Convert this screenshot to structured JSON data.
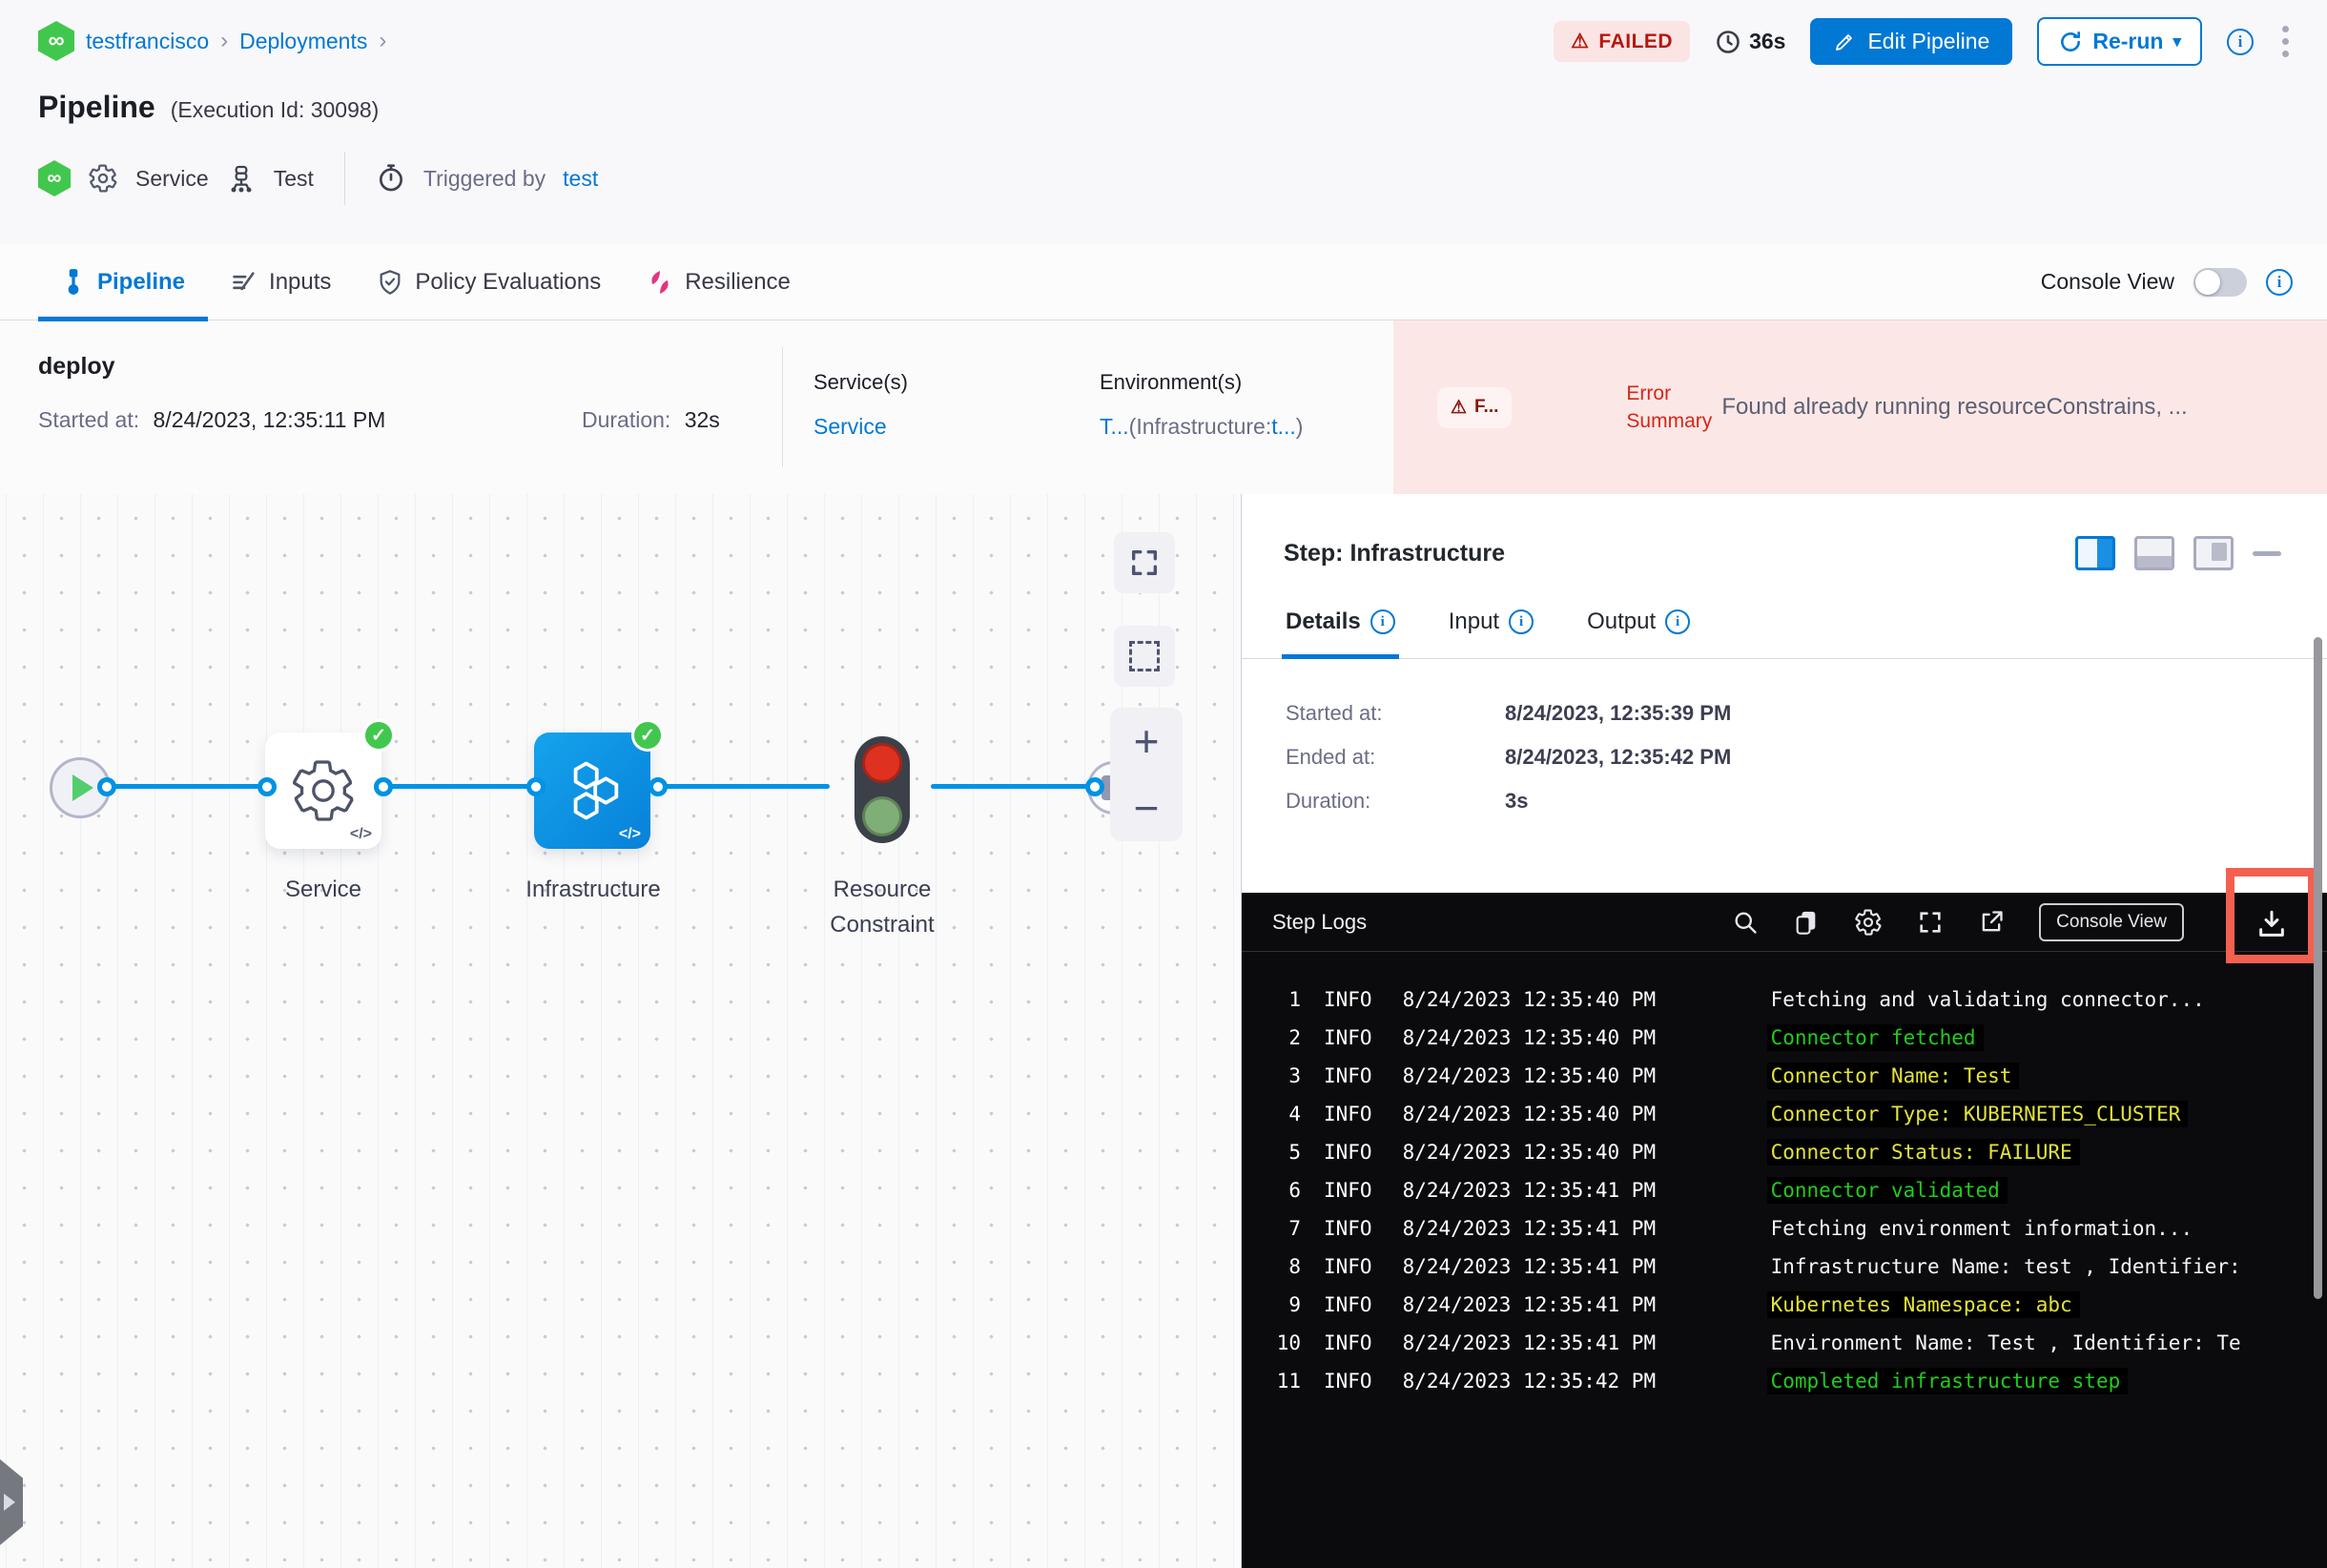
{
  "breadcrumb": {
    "project": "testfrancisco",
    "section": "Deployments"
  },
  "header": {
    "title": "Pipeline",
    "execution_id": "(Execution Id: 30098)",
    "status_badge": "FAILED",
    "elapsed": "36s",
    "edit_button": "Edit Pipeline",
    "rerun_button": "Re-run",
    "service_name": "Service",
    "environment_name": "Test",
    "triggered_by_label": "Triggered by",
    "triggered_by_value": "test"
  },
  "tabs": {
    "items": [
      "Pipeline",
      "Inputs",
      "Policy Evaluations",
      "Resilience"
    ],
    "console_view_label": "Console View"
  },
  "stage_bar": {
    "name": "deploy",
    "started_label": "Started at:",
    "started_value": "8/24/2023, 12:35:11 PM",
    "duration_label": "Duration:",
    "duration_value": "32s",
    "services_label": "Service(s)",
    "services_value": "Service",
    "environments_label": "Environment(s)",
    "env_link1": "T...",
    "env_mid": "(Infrastructure:",
    "env_link2": "t...",
    "env_close": ")",
    "error_badge": "F...",
    "error_label": "Error Summary",
    "error_message": "Found already running resourceConstrains, ..."
  },
  "graph": {
    "nodes": [
      {
        "label": "Service"
      },
      {
        "label": "Infrastructure"
      },
      {
        "label": "Resource Constraint"
      }
    ],
    "code_glyph": "</>"
  },
  "step_panel": {
    "title": "Step: Infrastructure",
    "tabs": [
      "Details",
      "Input",
      "Output"
    ],
    "details": [
      {
        "label": "Started at:",
        "value": "8/24/2023, 12:35:39 PM"
      },
      {
        "label": "Ended at:",
        "value": "8/24/2023, 12:35:42 PM"
      },
      {
        "label": "Duration:",
        "value": "3s"
      }
    ]
  },
  "logs": {
    "title": "Step Logs",
    "console_view_button": "Console View",
    "lines": [
      {
        "num": "1",
        "level": "INFO",
        "time": "8/24/2023 12:35:40 PM",
        "msg": "Fetching and validating connector...",
        "color": "white"
      },
      {
        "num": "2",
        "level": "INFO",
        "time": "8/24/2023 12:35:40 PM",
        "msg": "Connector fetched",
        "color": "green"
      },
      {
        "num": "3",
        "level": "INFO",
        "time": "8/24/2023 12:35:40 PM",
        "msg": "Connector Name: Test",
        "color": "yellow"
      },
      {
        "num": "4",
        "level": "INFO",
        "time": "8/24/2023 12:35:40 PM",
        "msg": "Connector Type: KUBERNETES_CLUSTER",
        "color": "yellow"
      },
      {
        "num": "5",
        "level": "INFO",
        "time": "8/24/2023 12:35:40 PM",
        "msg": "Connector Status: FAILURE",
        "color": "yellow"
      },
      {
        "num": "6",
        "level": "INFO",
        "time": "8/24/2023 12:35:41 PM",
        "msg": "Connector validated",
        "color": "green"
      },
      {
        "num": "7",
        "level": "INFO",
        "time": "8/24/2023 12:35:41 PM",
        "msg": "Fetching environment information...",
        "color": "white"
      },
      {
        "num": "8",
        "level": "INFO",
        "time": "8/24/2023 12:35:41 PM",
        "msg": "Infrastructure Name: test , Identifier:",
        "color": "white"
      },
      {
        "num": "9",
        "level": "INFO",
        "time": "8/24/2023 12:35:41 PM",
        "msg": "Kubernetes Namespace: abc",
        "color": "yellow"
      },
      {
        "num": "10",
        "level": "INFO",
        "time": "8/24/2023 12:35:41 PM",
        "msg": "Environment Name: Test , Identifier: Te",
        "color": "white"
      },
      {
        "num": "11",
        "level": "INFO",
        "time": "8/24/2023 12:35:42 PM",
        "msg": "Completed infrastructure step",
        "color": "green"
      }
    ]
  },
  "colors": {
    "primary_blue": "#0278d5",
    "edge_blue": "#0092e4",
    "failed_red": "#b41710",
    "error_bg": "#fbe8e6",
    "success_green": "#42c74e",
    "log_green": "#21cd1c",
    "log_yellow": "#e3e339",
    "highlight_red": "#f4604f"
  }
}
